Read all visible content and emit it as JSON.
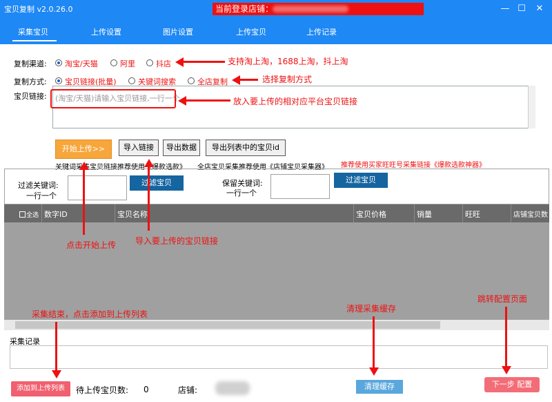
{
  "window": {
    "title": "宝贝复制 v2.0.26.0",
    "login_prefix": "当前登录店铺：",
    "minimize": "—",
    "maximize": "☐",
    "close": "✕"
  },
  "tabs": [
    "采集宝贝",
    "上传设置",
    "图片设置",
    "上传宝贝",
    "上传记录"
  ],
  "channel": {
    "label": "复制渠道:",
    "options": [
      "淘宝/天猫",
      "阿里",
      "抖店"
    ],
    "selected": 0
  },
  "mode": {
    "label": "复制方式:",
    "options": [
      "宝贝链接(批量)",
      "关键词搜索",
      "全店复制"
    ],
    "selected": 0
  },
  "link": {
    "label": "宝贝链接:",
    "placeholder": "(淘宝/天猫)请输入宝贝链接,一行一个"
  },
  "buttons": {
    "start": "开始上传>>",
    "import": "导入链接",
    "export": "导出数据",
    "export_ids": "导出列表中的宝贝id"
  },
  "hints": {
    "keyword": "关键词采集宝贝链接推荐使用《爆款选款》",
    "shop": "全店宝贝采集推荐使用《店铺宝贝采集器》",
    "red": "推荐使用买家旺旺号采集链接《爆款选款神器》"
  },
  "filter": {
    "label_line1": "过滤关键词:",
    "label_line2": "一行一个",
    "button": "过滤宝贝"
  },
  "keep": {
    "label_line1": "保留关键词:",
    "label_line2": "一行一个",
    "button": "过滤宝贝"
  },
  "table": {
    "columns": [
      "全选",
      "数字ID",
      "宝贝名称",
      "宝贝价格",
      "销量",
      "旺旺",
      "店铺宝贝数"
    ]
  },
  "record": {
    "label": "采集记录"
  },
  "footer": {
    "add_button": "添加到上传列表",
    "pending_label": "待上传宝贝数:",
    "pending_count": "0",
    "shop_label": "店铺:",
    "clear_button": "清理缓存",
    "next_button": "下一步 配置"
  },
  "annotations": {
    "channels": "支持淘上淘，1688上淘，抖上淘",
    "mode": "选择复制方式",
    "links": "放入要上传的相对应平台宝贝链接",
    "start": "点击开始上传",
    "import": "导入要上传的宝贝链接",
    "finish": "采集结束，点击添加到上传列表",
    "clear": "清理采集缓存",
    "config": "跳转配置页面"
  }
}
